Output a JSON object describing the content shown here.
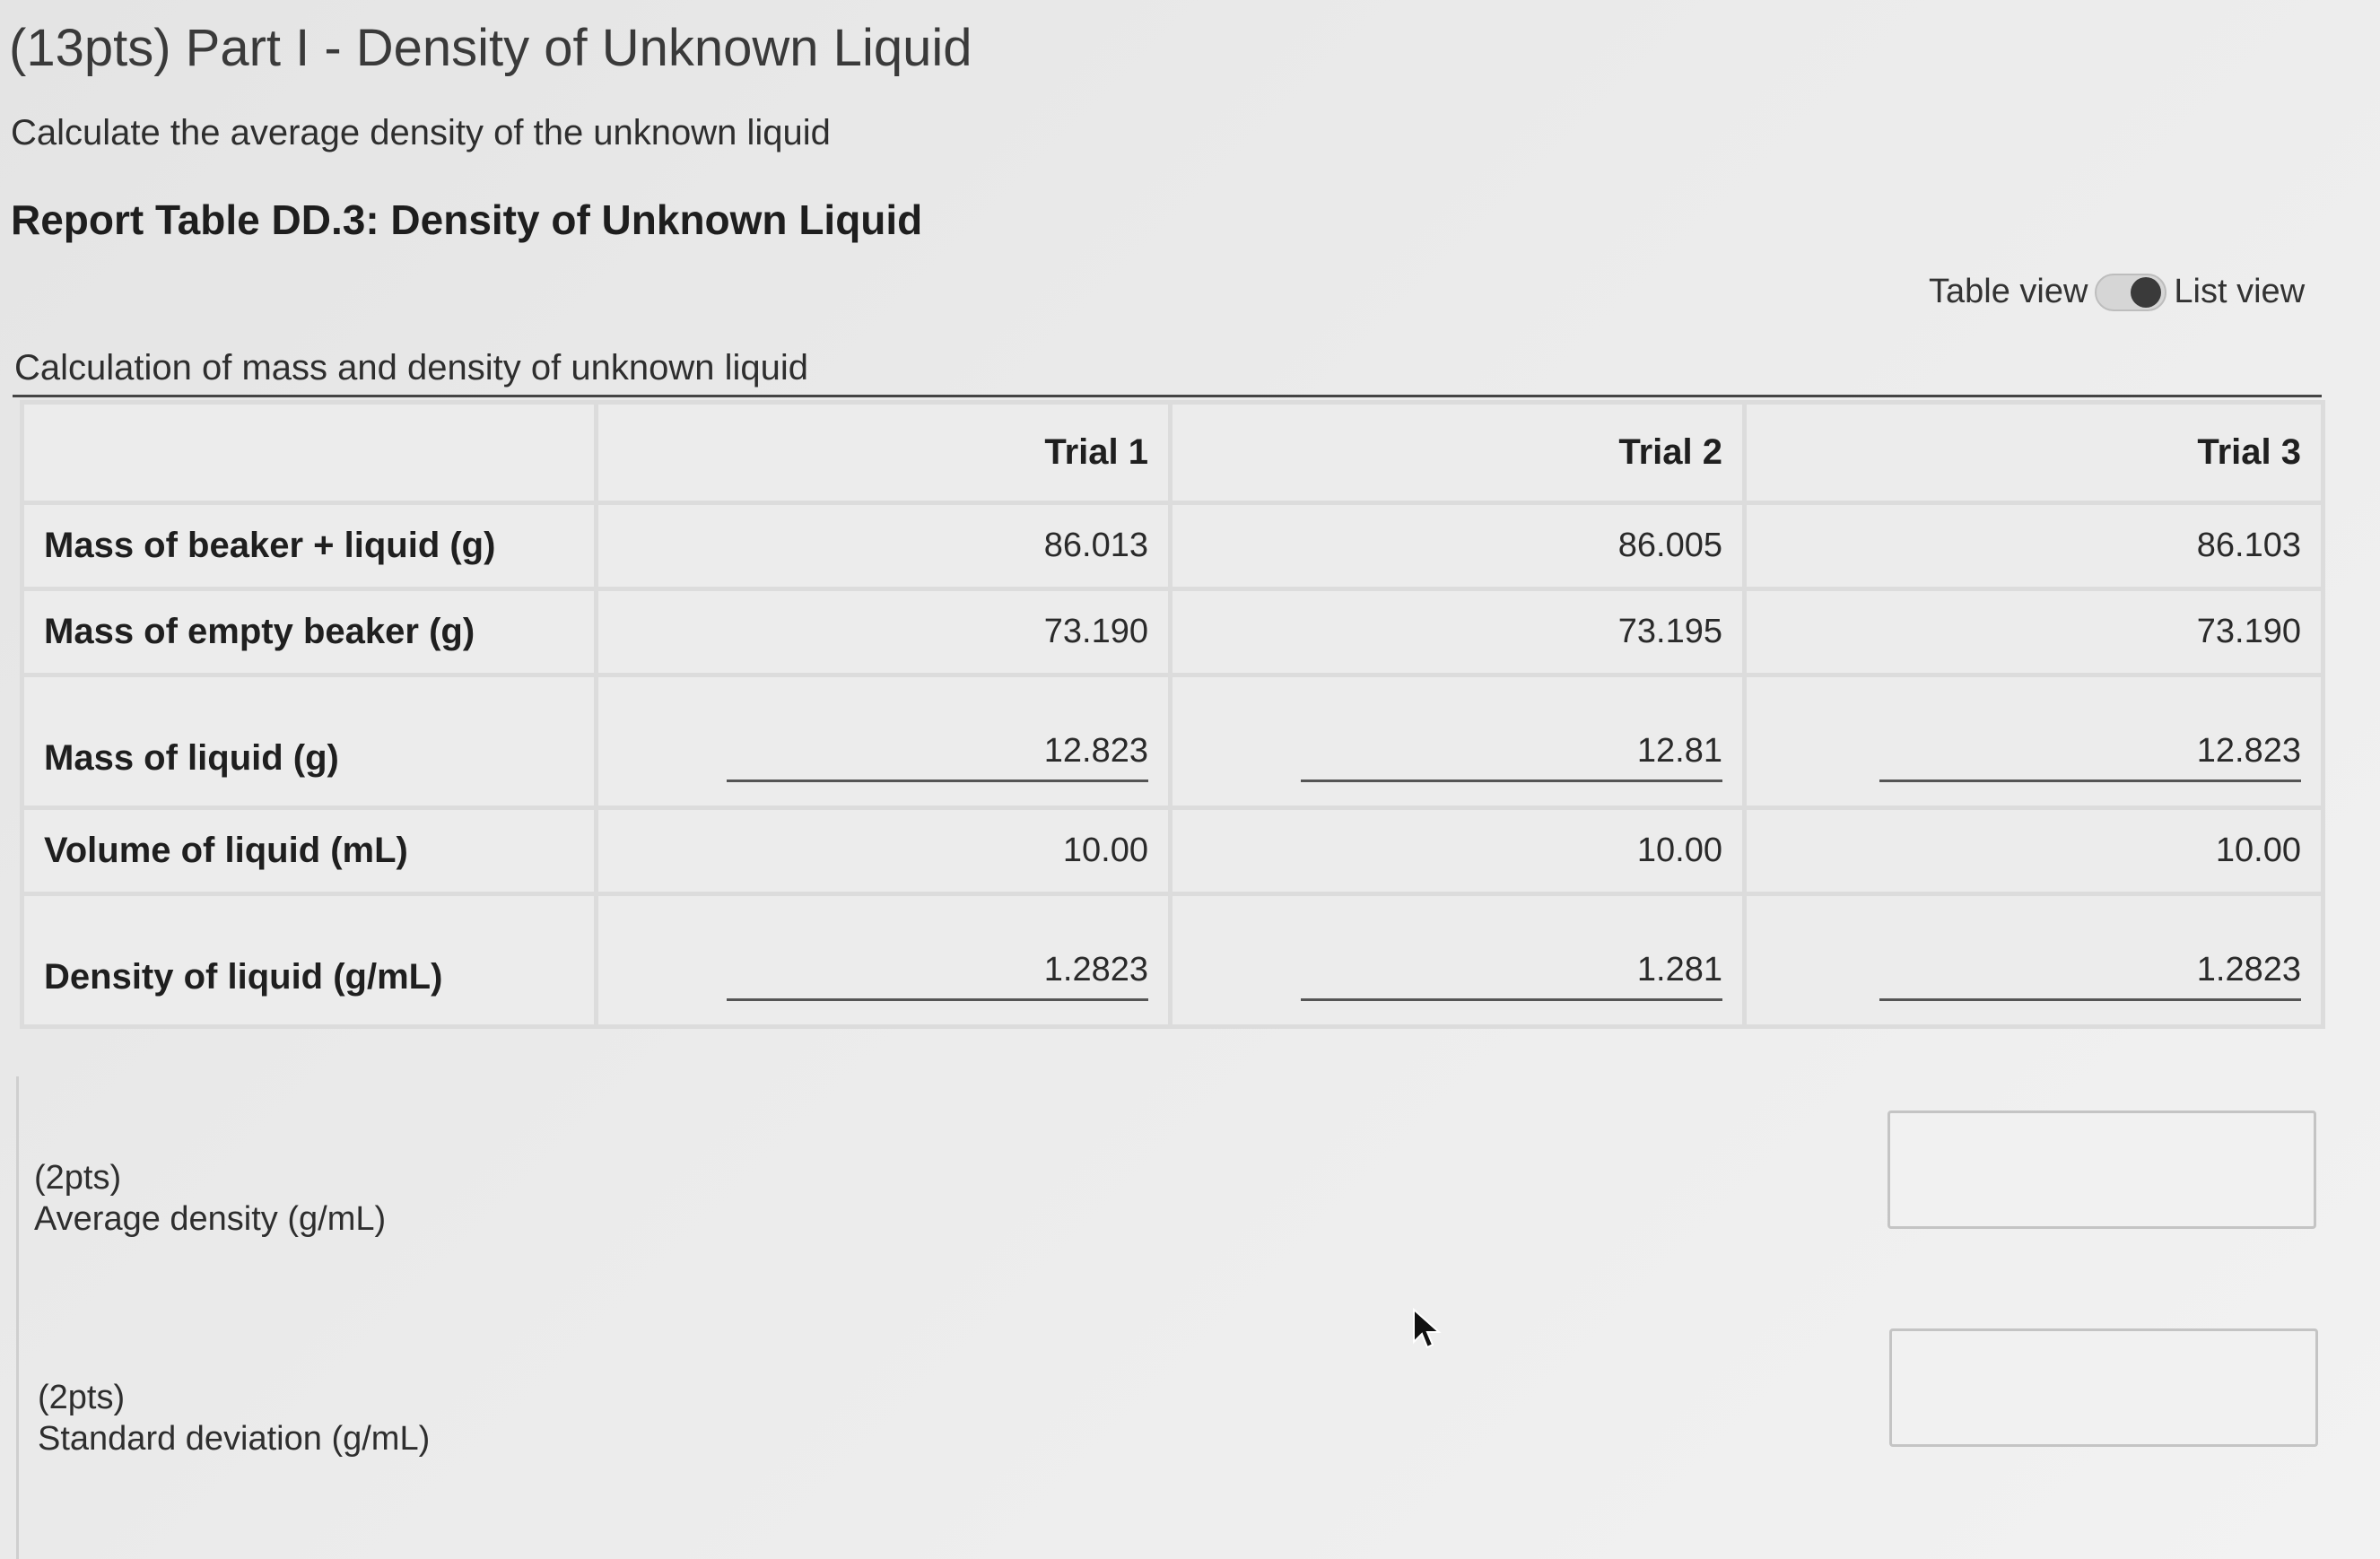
{
  "page": {
    "part_title": "(13pts) Part I - Density of Unknown Liquid",
    "instructions": "Calculate the average density of the unknown liquid",
    "report_title": "Report Table DD.3: Density of Unknown Liquid"
  },
  "view_toggle": {
    "table_label": "Table view",
    "list_label": "List view",
    "selected": "List view"
  },
  "table": {
    "caption": "Calculation of mass and density of unknown liquid",
    "headers": [
      "",
      "Trial 1",
      "Trial 2",
      "Trial 3"
    ],
    "rows": [
      {
        "label": "Mass of beaker + liquid (g)",
        "values": [
          "86.013",
          "86.005",
          "86.103"
        ]
      },
      {
        "label": "Mass of empty beaker (g)",
        "values": [
          "73.190",
          "73.195",
          "73.190"
        ]
      },
      {
        "label": "Mass of liquid (g)",
        "values": [
          "12.823",
          "12.81",
          "12.823"
        ]
      },
      {
        "label": "Volume of liquid (mL)",
        "values": [
          "10.00",
          "10.00",
          "10.00"
        ]
      },
      {
        "label": "Density of liquid (g/mL)",
        "values": [
          "1.2823",
          "1.281",
          "1.2823"
        ]
      }
    ]
  },
  "questions": {
    "average": {
      "points": "(2pts)",
      "label": "Average density (g/mL)",
      "value": ""
    },
    "std_dev": {
      "points": "(2pts)",
      "label": "Standard deviation (g/mL)",
      "value": ""
    }
  },
  "icons": {
    "cursor": "mouse-pointer-icon"
  }
}
